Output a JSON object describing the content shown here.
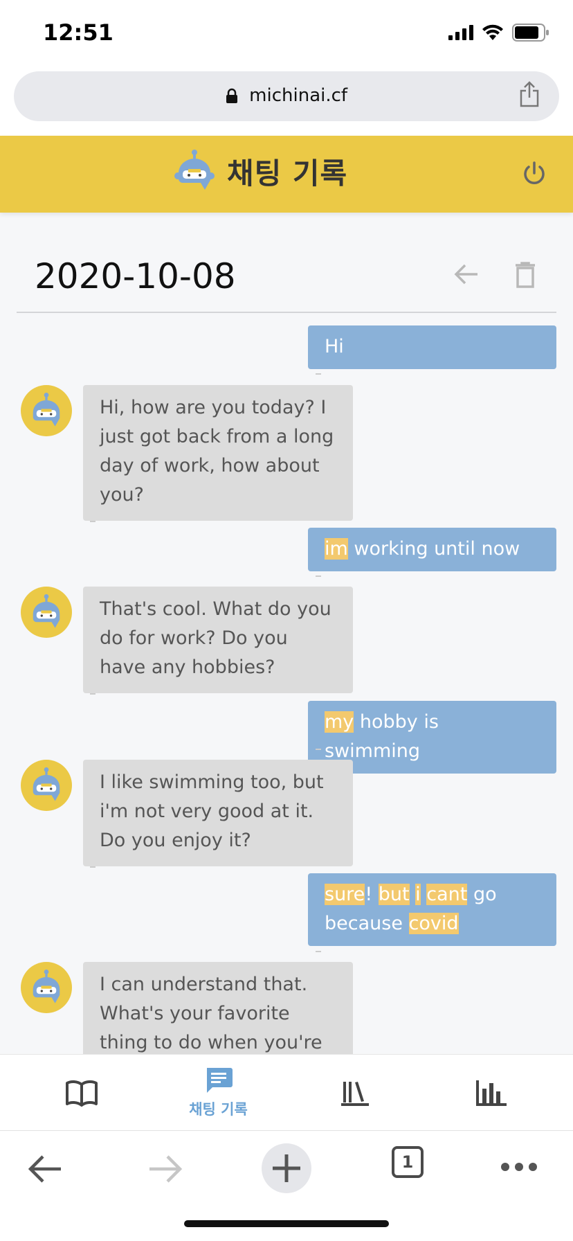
{
  "status_bar": {
    "time": "12:51"
  },
  "browser": {
    "url": "michinai.cf",
    "tab_count": "1"
  },
  "header": {
    "title": "채팅 기록"
  },
  "chat": {
    "date": "2020-10-08",
    "messages": [
      {
        "role": "user",
        "parts": [
          {
            "t": "Hi",
            "hl": false
          }
        ]
      },
      {
        "role": "bot",
        "text": "Hi, how are you today? I just got back from a long day of work, how about you?"
      },
      {
        "role": "user",
        "parts": [
          {
            "t": "im",
            "hl": true
          },
          {
            "t": " working until now",
            "hl": false
          }
        ]
      },
      {
        "role": "bot",
        "text": "That's cool. What do you do for work? Do you have any hobbies?"
      },
      {
        "role": "user",
        "parts": [
          {
            "t": "my",
            "hl": true
          },
          {
            "t": " hobby is swimming",
            "hl": false
          }
        ]
      },
      {
        "role": "bot",
        "text": "I like swimming too, but i'm not very good at it. Do you enjoy it?"
      },
      {
        "role": "user",
        "parts": [
          {
            "t": "sure",
            "hl": true
          },
          {
            "t": "! ",
            "hl": false
          },
          {
            "t": "but",
            "hl": true
          },
          {
            "t": " ",
            "hl": false
          },
          {
            "t": "i",
            "hl": true
          },
          {
            "t": " ",
            "hl": false
          },
          {
            "t": "cant",
            "hl": true
          },
          {
            "t": " go because ",
            "hl": false
          },
          {
            "t": "covid",
            "hl": true
          }
        ]
      },
      {
        "role": "bot",
        "text": "I can understand that. What's your favorite thing to do when you're not"
      }
    ]
  },
  "tabbar": {
    "items": [
      {
        "icon": "book-icon",
        "label": ""
      },
      {
        "icon": "chat-icon",
        "label": "채팅 기록",
        "active": true
      },
      {
        "icon": "library-icon",
        "label": ""
      },
      {
        "icon": "bar-chart-icon",
        "label": ""
      }
    ]
  },
  "colors": {
    "header": "#ebc946",
    "user_bubble": "#8ab1d8",
    "bot_bubble": "#dcdcdc",
    "highlight": "#f3c96e",
    "active_tab": "#6aa2d4"
  }
}
